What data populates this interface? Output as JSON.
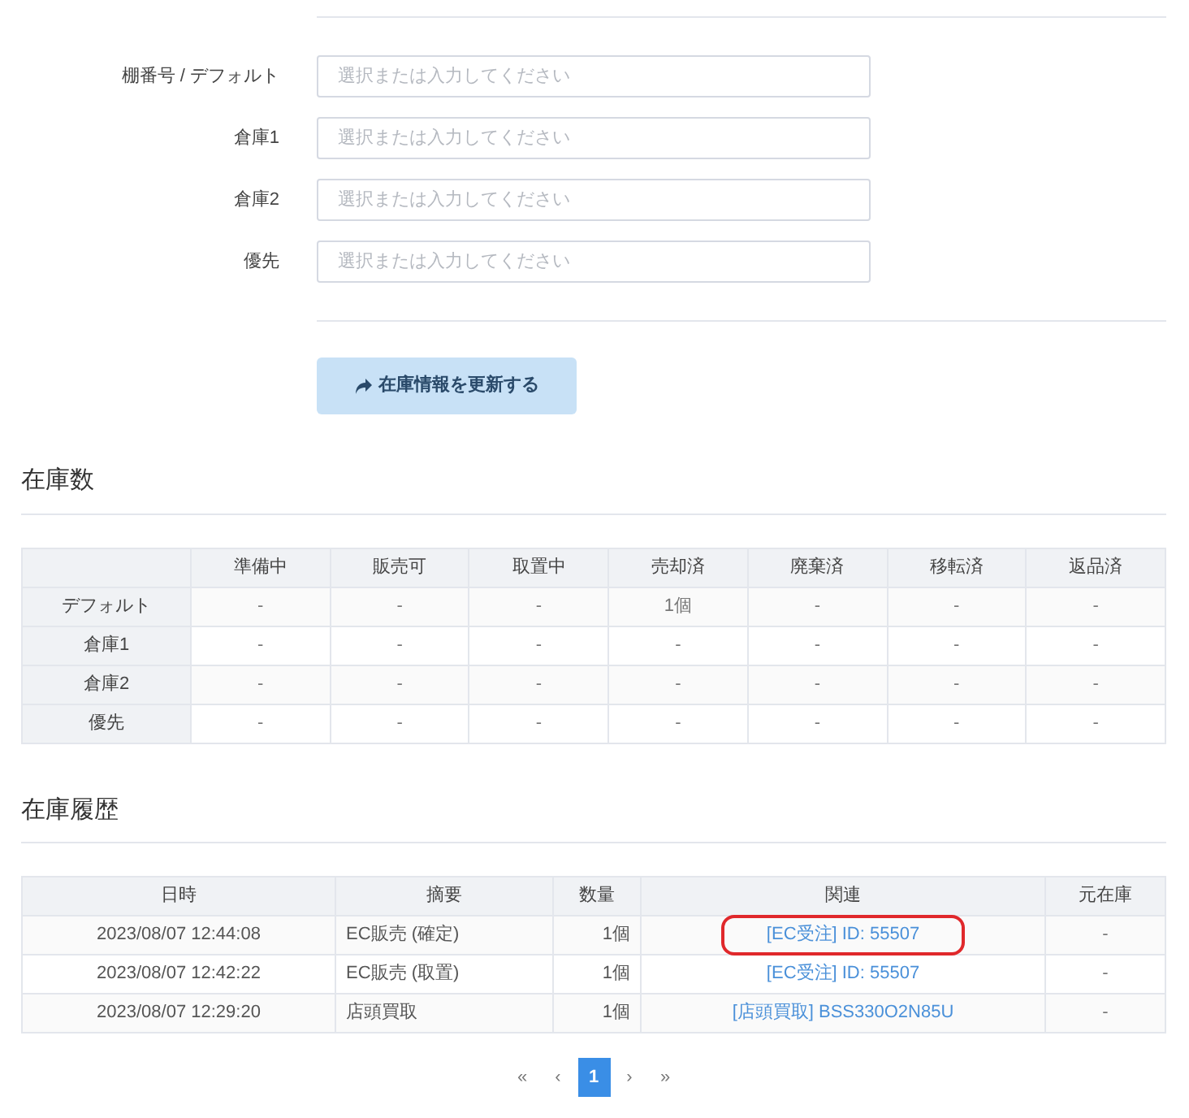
{
  "form": {
    "fields": [
      {
        "label": "棚番号 / デフォルト",
        "placeholder": "選択または入力してください"
      },
      {
        "label": "倉庫1",
        "placeholder": "選択または入力してください"
      },
      {
        "label": "倉庫2",
        "placeholder": "選択または入力してください"
      },
      {
        "label": "優先",
        "placeholder": "選択または入力してください"
      }
    ],
    "submit": "在庫情報を更新する"
  },
  "stock": {
    "title": "在庫数",
    "columns": [
      "準備中",
      "販売可",
      "取置中",
      "売却済",
      "廃棄済",
      "移転済",
      "返品済"
    ],
    "rows": [
      {
        "label": "デフォルト",
        "cells": [
          "-",
          "-",
          "-",
          "1個",
          "-",
          "-",
          "-"
        ]
      },
      {
        "label": "倉庫1",
        "cells": [
          "-",
          "-",
          "-",
          "-",
          "-",
          "-",
          "-"
        ]
      },
      {
        "label": "倉庫2",
        "cells": [
          "-",
          "-",
          "-",
          "-",
          "-",
          "-",
          "-"
        ]
      },
      {
        "label": "優先",
        "cells": [
          "-",
          "-",
          "-",
          "-",
          "-",
          "-",
          "-"
        ]
      }
    ]
  },
  "history": {
    "title": "在庫履歴",
    "columns": [
      "日時",
      "摘要",
      "数量",
      "関連",
      "元在庫"
    ],
    "rows": [
      {
        "datetime": "2023/08/07 12:44:08",
        "summary": "EC販売 (確定)",
        "quantity": "1個",
        "related": "[EC受注] ID: 55507",
        "highlighted": true,
        "source": "-"
      },
      {
        "datetime": "2023/08/07 12:42:22",
        "summary": "EC販売 (取置)",
        "quantity": "1個",
        "related": "[EC受注] ID: 55507",
        "highlighted": false,
        "source": "-"
      },
      {
        "datetime": "2023/08/07 12:29:20",
        "summary": "店頭買取",
        "quantity": "1個",
        "related": "[店頭買取] BSS330O2N85U",
        "highlighted": false,
        "source": "-"
      }
    ]
  },
  "pagination": [
    {
      "label": "«",
      "selected": false
    },
    {
      "label": "‹",
      "selected": false
    },
    {
      "label": "1",
      "selected": true
    },
    {
      "label": "›",
      "selected": false
    },
    {
      "label": "»",
      "selected": false
    }
  ]
}
